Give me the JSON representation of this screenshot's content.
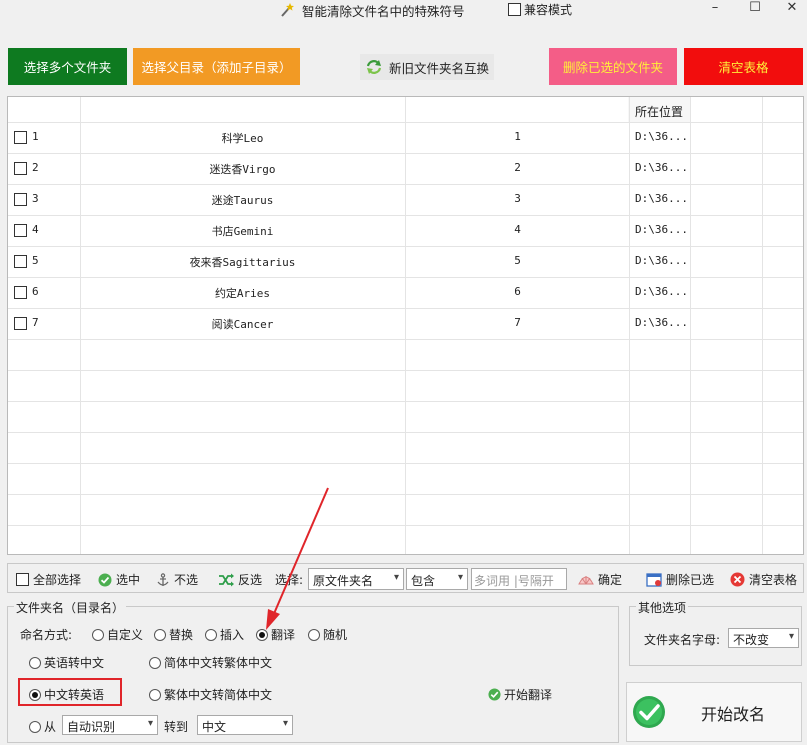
{
  "window": {
    "title": "智能清除文件名中的特殊符号",
    "compat_mode": "兼容模式",
    "minimize": "–",
    "maximize": "☐",
    "close": "✕"
  },
  "toolbar": {
    "select_folders": "选择多个文件夹",
    "select_parent": "选择父目录（添加子目录）",
    "swap_names": "新旧文件夹名互换",
    "delete_selected": "删除已选的文件夹",
    "clear_table": "清空表格"
  },
  "table": {
    "header_location": "所在位置",
    "rows": [
      {
        "idx": "1",
        "name": "科学Leo",
        "num": "1",
        "loc": "D:\\36..."
      },
      {
        "idx": "2",
        "name": "迷迭香Virgo",
        "num": "2",
        "loc": "D:\\36..."
      },
      {
        "idx": "3",
        "name": "迷途Taurus",
        "num": "3",
        "loc": "D:\\36..."
      },
      {
        "idx": "4",
        "name": "书店Gemini",
        "num": "4",
        "loc": "D:\\36..."
      },
      {
        "idx": "5",
        "name": "夜来香Sagittarius",
        "num": "5",
        "loc": "D:\\36..."
      },
      {
        "idx": "6",
        "name": "约定Aries",
        "num": "6",
        "loc": "D:\\36..."
      },
      {
        "idx": "7",
        "name": "阅读Cancer",
        "num": "7",
        "loc": "D:\\36..."
      }
    ]
  },
  "selection": {
    "select_all": "全部选择",
    "select": "选中",
    "unselect": "不选",
    "invert": "反选",
    "choose_label": "选择:",
    "field_value": "原文件夹名",
    "match_value": "包含",
    "keyword_placeholder": "多词用 |号隔开",
    "confirm": "确定",
    "delete_selected": "删除已选",
    "clear_table": "清空表格"
  },
  "naming": {
    "group_title": "文件夹名（目录名）",
    "mode_label": "命名方式:",
    "modes": [
      "自定义",
      "替换",
      "插入",
      "翻译",
      "随机"
    ],
    "selected_mode": "翻译",
    "translate_options": {
      "en_to_cn": "英语转中文",
      "simp_to_trad": "简体中文转繁体中文",
      "cn_to_en": "中文转英语",
      "trad_to_simp": "繁体中文转简体中文",
      "from_label": "从",
      "from_value": "自动识别",
      "to_label": "转到",
      "to_value": "中文"
    },
    "start_translate": "开始翻译"
  },
  "other": {
    "group_title": "其他选项",
    "letter_label": "文件夹名字母:",
    "letter_value": "不改变"
  },
  "start_rename": "开始改名"
}
